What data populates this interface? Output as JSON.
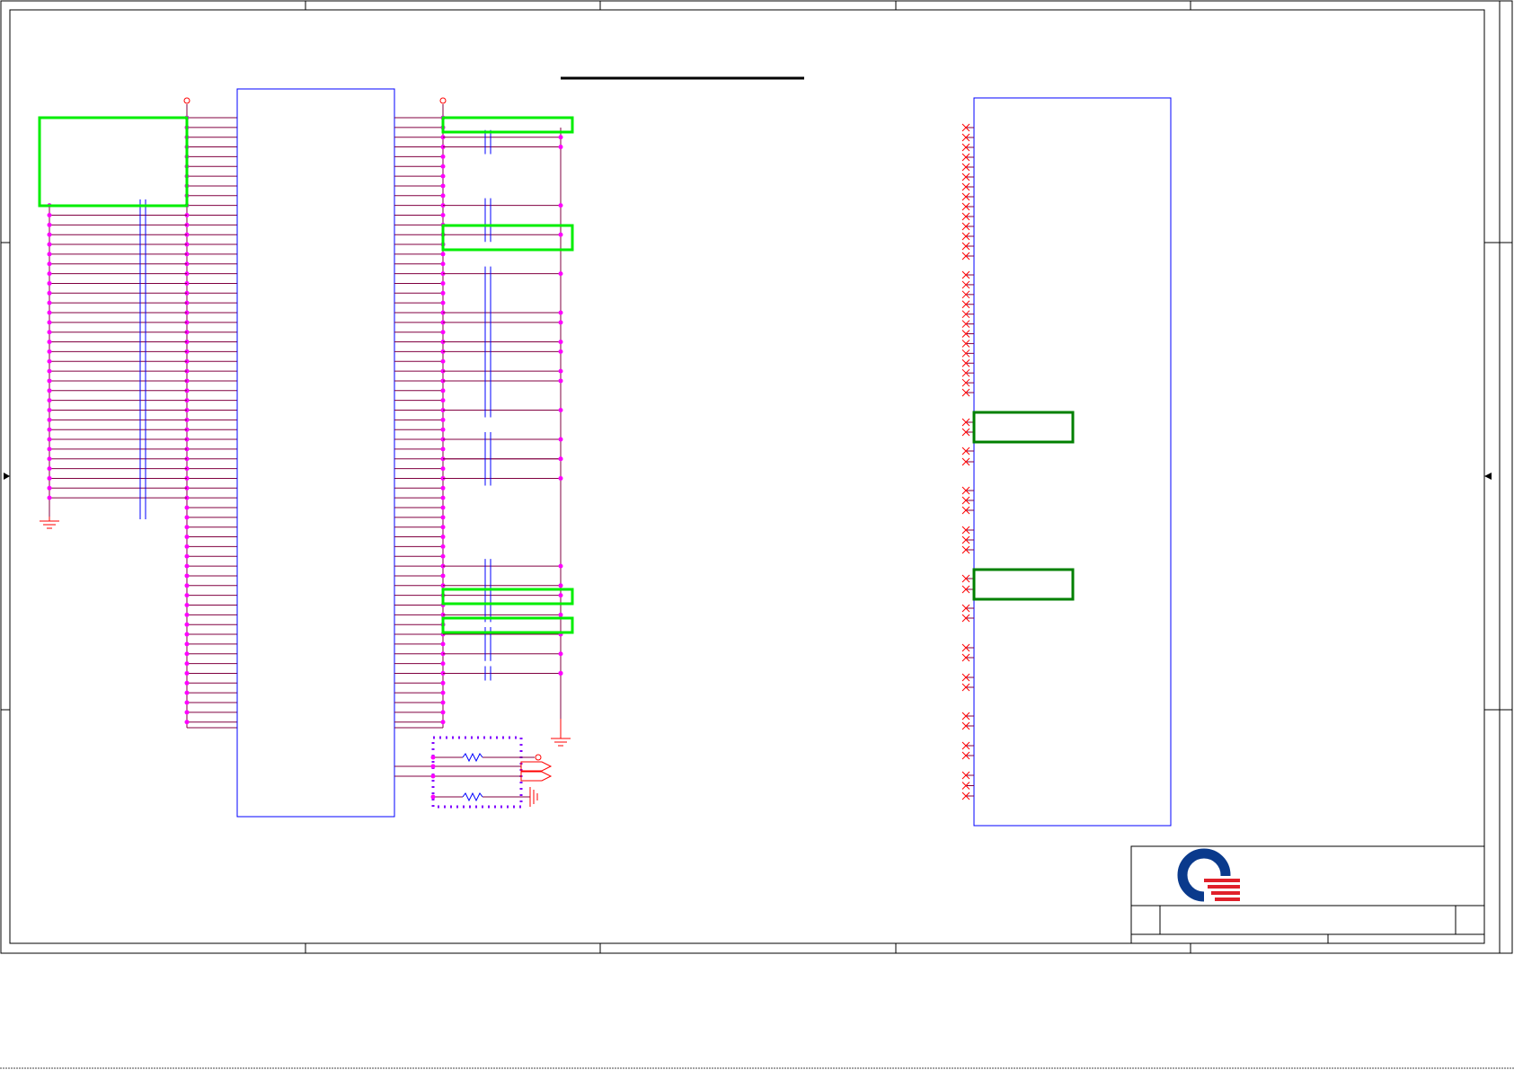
{
  "colors": {
    "frame": "#000000",
    "component_outline": "#0000ff",
    "net_wire": "#800040",
    "junction": "#ff00ff",
    "power": "#ff0000",
    "highlight_box": "#00ff00",
    "highlight_box_dark": "#008000",
    "resistor_group_box": "#8000ff",
    "capacitor": "#0000ff",
    "logo_blue": "#0a3a8c",
    "logo_red": "#e0202a"
  },
  "icons": {
    "power_flag": "power-pin-icon",
    "ground": "ground-icon",
    "no_connect": "no-connect-icon",
    "capacitor": "capacitor-icon",
    "resistor": "resistor-icon",
    "port": "port-arrow-icon",
    "company_logo": "logo-q-icon"
  },
  "title_block": {
    "company_name": "",
    "title": "",
    "size": "",
    "rev": "",
    "sheet": "",
    "date": ""
  }
}
